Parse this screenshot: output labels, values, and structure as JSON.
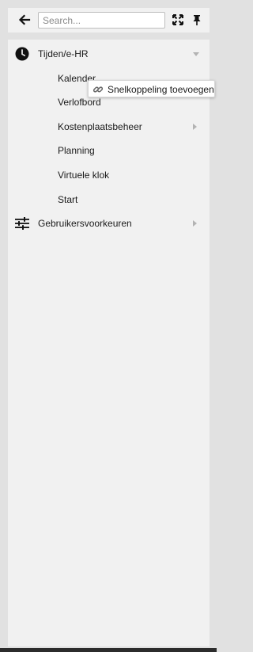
{
  "header": {
    "search_placeholder": "Search...",
    "search_value": ""
  },
  "menu": {
    "sections": [
      {
        "label": "Tijden/e-HR",
        "icon": "clock-icon",
        "expanded": true,
        "items": [
          {
            "label": "Kalender"
          },
          {
            "label": "Verlofbord"
          },
          {
            "label": "Kostenplaatsbeheer",
            "has_submenu": true
          },
          {
            "label": "Planning"
          },
          {
            "label": "Virtuele klok"
          },
          {
            "label": "Start"
          }
        ]
      },
      {
        "label": "Gebruikersvoorkeuren",
        "icon": "sliders-icon",
        "expanded": false,
        "has_submenu": true
      }
    ]
  },
  "tooltip": {
    "label": "Snelkoppeling toevoegen",
    "icon": "link-icon"
  },
  "colors": {
    "page_background": "#e1e1e1",
    "panel_background": "#f1f1f1",
    "caret": "#b3b3b3"
  }
}
